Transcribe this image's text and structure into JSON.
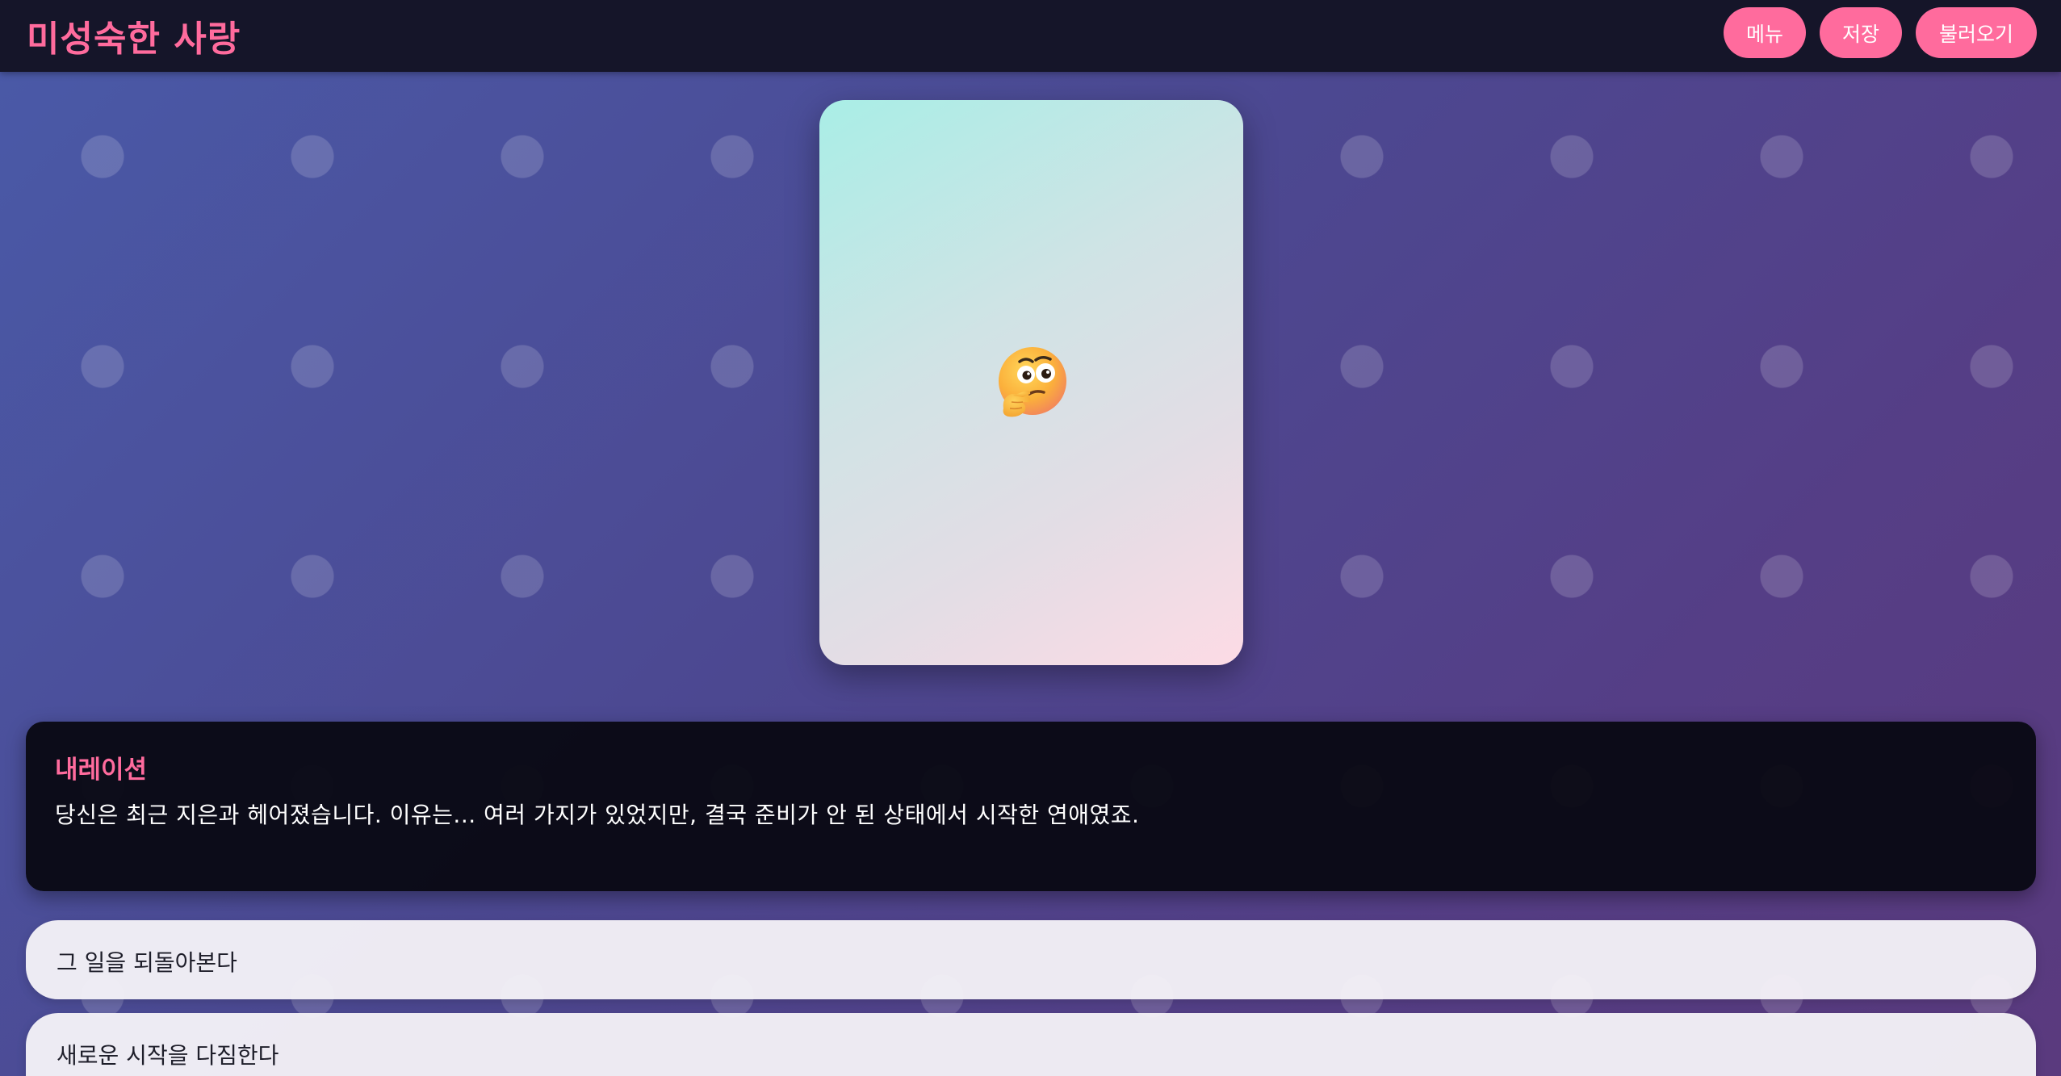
{
  "header": {
    "title": "미성숙한 사랑",
    "buttons": {
      "menu": "메뉴",
      "save": "저장",
      "load": "불러오기"
    }
  },
  "portrait": {
    "icon": "thinking-face-icon"
  },
  "dialogue": {
    "speaker": "내레이션",
    "text": "당신은 최근 지은과 헤어졌습니다. 이유는... 여러 가지가 있었지만, 결국 준비가 안 된 상태에서 시작한 연애였죠."
  },
  "choices": [
    {
      "label": "그 일을 되돌아본다"
    },
    {
      "label": "새로운 시작을 다짐한다"
    }
  ],
  "colors": {
    "accent": "#ff6b9d",
    "topbar": "#151529",
    "dialogue_bg": "#080812",
    "choice_bg": "#f5f3f8"
  }
}
